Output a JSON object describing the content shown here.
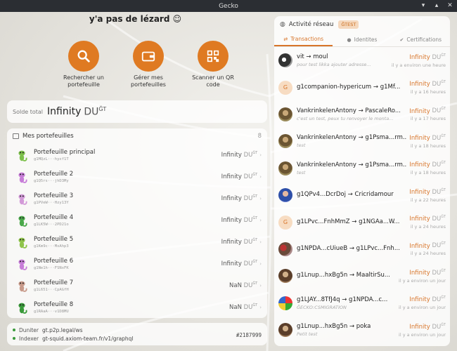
{
  "window": {
    "title": "Gecko"
  },
  "greeting": "y'a pas de lézard ☺",
  "actions": [
    {
      "label": "Rechercher un portefeuille",
      "icon": "search-icon"
    },
    {
      "label": "Gérer mes portefeuilles",
      "icon": "wallet-icon"
    },
    {
      "label": "Scanner un QR code",
      "icon": "qr-code-icon"
    }
  ],
  "balance": {
    "label": "Solde total",
    "value": "Infinity",
    "unit": "DU",
    "unit_sup": "ĞT"
  },
  "wallets": {
    "title": "Mes portefeuilles",
    "count": "8",
    "items": [
      {
        "name": "Portefeuille principal",
        "address": "g1MQzL···hyxf1T",
        "amount": "Infinity",
        "unit": "DU",
        "unit_sup": "ĞT"
      },
      {
        "name": "Portefeuille 2",
        "address": "g1Q5rs···jhD3My",
        "amount": "Infinity",
        "unit": "DU",
        "unit_sup": "ĞT"
      },
      {
        "name": "Portefeuille 3",
        "address": "g1PVeW···Hzy13Y",
        "amount": "Infinity",
        "unit": "DU",
        "unit_sup": "ĞT"
      },
      {
        "name": "Portefeuille 4",
        "address": "g1LK5W···2PD21o",
        "amount": "Infinity",
        "unit": "DU",
        "unit_sup": "ĞT"
      },
      {
        "name": "Portefeuille 5",
        "address": "g1Km9c···MxAhp3",
        "amount": "Infinity",
        "unit": "DU",
        "unit_sup": "ĞT"
      },
      {
        "name": "Portefeuille 6",
        "address": "g1Ne1h···FSNxFK",
        "amount": "Infinity",
        "unit": "DU",
        "unit_sup": "ĞT"
      },
      {
        "name": "Portefeuille 7",
        "address": "g1L651···CpAGfH",
        "amount": "NaN",
        "unit": "DU",
        "unit_sup": "ĞT"
      },
      {
        "name": "Portefeuille 8",
        "address": "g1RAaA···v1D8MU",
        "amount": "NaN",
        "unit": "DU",
        "unit_sup": "ĞT"
      }
    ]
  },
  "nodes": {
    "duniter_label": "Duniter",
    "duniter_url": "gt.p2p.legal/ws",
    "indexer_label": "Indexer",
    "indexer_url": "gt-squid.axiom-team.fr/v1/graphql",
    "block": "#2187999"
  },
  "network": {
    "title": "Activité réseau",
    "badge": "ĞTEST",
    "tabs": [
      {
        "label": "Transactions",
        "icon": "swap-icon"
      },
      {
        "label": "Identites",
        "icon": "person-icon"
      },
      {
        "label": "Certifications",
        "icon": "check-circle-icon"
      }
    ],
    "transactions": [
      {
        "who": "vit → moul",
        "comment": "pour test likka ajouter adresse...",
        "amount": "Infinity",
        "unit": "DU",
        "unit_sup": "ĞT",
        "time": "il y a environ une heure",
        "avatar": "photo-dark"
      },
      {
        "who": "g1companion-hypericum → g1Mf...",
        "comment": "",
        "amount": "Infinity",
        "unit": "DU",
        "unit_sup": "ĞT",
        "time": "il y a 16 heures",
        "avatar": "G"
      },
      {
        "who": "VankrinkelenAntony → PascaleRo...",
        "comment": "c'est un test, peux tu renvoyer le monta...",
        "amount": "Infinity",
        "unit": "DU",
        "unit_sup": "ĞT",
        "time": "il y a 17 heures",
        "avatar": "gecko"
      },
      {
        "who": "VankrinkelenAntony → g1Psma...rm...",
        "comment": "test",
        "amount": "Infinity",
        "unit": "DU",
        "unit_sup": "ĞT",
        "time": "il y a 18 heures",
        "avatar": "gecko"
      },
      {
        "who": "VankrinkelenAntony → g1Psma...rm...",
        "comment": "test",
        "amount": "Infinity",
        "unit": "DU",
        "unit_sup": "ĞT",
        "time": "il y a 18 heures",
        "avatar": "gecko"
      },
      {
        "who": "g1QPv4...DcrDoj → Cricridamour",
        "comment": "",
        "amount": "Infinity",
        "unit": "DU",
        "unit_sup": "ĞT",
        "time": "il y a 22 heures",
        "avatar": "photo-blue"
      },
      {
        "who": "g1LPvc...FnhMmZ → g1NGAa...W...",
        "comment": "",
        "amount": "Infinity",
        "unit": "DU",
        "unit_sup": "ĞT",
        "time": "il y a 24 heures",
        "avatar": "G"
      },
      {
        "who": "g1NPDA...cUiueB → g1LPvc...Fnh...",
        "comment": "",
        "amount": "Infinity",
        "unit": "DU",
        "unit_sup": "ĞT",
        "time": "il y a 24 heures",
        "avatar": "photo-red"
      },
      {
        "who": "g1Lnup...hxBg5n → MaaltirSu...",
        "comment": "",
        "amount": "Infinity",
        "unit": "DU",
        "unit_sup": "ĞT",
        "time": "il y a environ un jour",
        "avatar": "photo-brown"
      },
      {
        "who": "g1LJAY...8TfJ4q → g1NPDA...c...",
        "comment": "ĞECKO:CSMIGRATION",
        "amount": "Infinity",
        "unit": "DU",
        "unit_sup": "ĞT",
        "time": "il y a environ un jour",
        "avatar": "photo-multi"
      },
      {
        "who": "g1Lnup...hxBg5n → poka",
        "comment": "Petit test",
        "amount": "Infinity",
        "unit": "DU",
        "unit_sup": "ĞT",
        "time": "il y a environ un jour",
        "avatar": "photo-brown"
      }
    ]
  },
  "colors": {
    "accent": "#df7a22",
    "window_bar": "#2b2e33",
    "status_green": "#3a9a3a"
  }
}
